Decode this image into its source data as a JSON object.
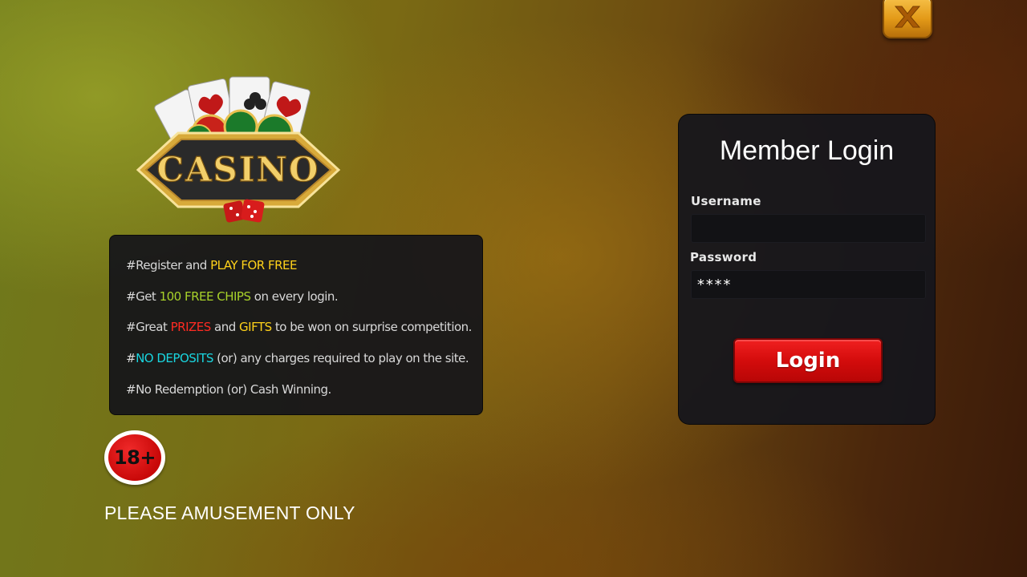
{
  "close_button": {
    "icon": "close-icon"
  },
  "logo": {
    "text": "CASINO",
    "icon": "casino-logo"
  },
  "info": {
    "lines": [
      [
        {
          "text": "#Register and ",
          "color": "default"
        },
        {
          "text": "PLAY FOR FREE",
          "color": "yellow"
        }
      ],
      [
        {
          "text": "#Get ",
          "color": "default"
        },
        {
          "text": "100 FREE CHIPS",
          "color": "green"
        },
        {
          "text": " on every login.",
          "color": "default"
        }
      ],
      [
        {
          "text": "#Great ",
          "color": "default"
        },
        {
          "text": "PRIZES",
          "color": "red"
        },
        {
          "text": " and ",
          "color": "default"
        },
        {
          "text": "GIFTS",
          "color": "yellow"
        },
        {
          "text": " to be won on surprise competition.",
          "color": "default"
        }
      ],
      [
        {
          "text": "#",
          "color": "default"
        },
        {
          "text": "NO DEPOSITS",
          "color": "cyan"
        },
        {
          "text": " (or) any charges required to play on the site.",
          "color": "default"
        }
      ],
      [
        {
          "text": "#No Redemption (or) Cash Winning.",
          "color": "default"
        }
      ]
    ]
  },
  "age_badge": {
    "text": "18+"
  },
  "amusement_text": "PLEASE AMUSEMENT ONLY",
  "login": {
    "title": "Member Login",
    "username_label": "Username",
    "username_value": "",
    "password_label": "Password",
    "password_value": "****",
    "button_label": "Login"
  },
  "colors": {
    "yellow": "#ffd21a",
    "green": "#a8d22a",
    "red": "#ff2b22",
    "cyan": "#19d6e0",
    "login_button": "#d40c0c",
    "close_button": "#e39a18"
  }
}
